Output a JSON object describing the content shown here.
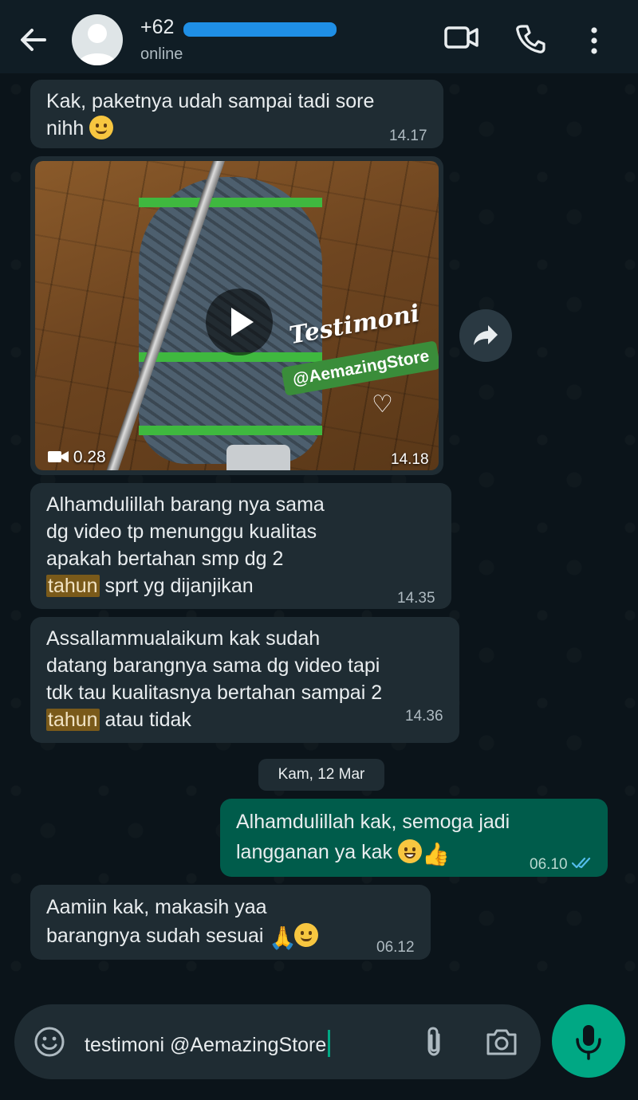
{
  "header": {
    "contact_name": "+62",
    "status": "online",
    "icons": [
      "back-arrow-icon",
      "video-call-icon",
      "voice-call-icon",
      "more-options-icon"
    ]
  },
  "messages": {
    "m1": {
      "line1": "Kak, paketnya udah sampai tadi sore",
      "line2": "nihh",
      "time": "14.17"
    },
    "video": {
      "overlay_title": "Testimoni",
      "overlay_handle": "@AemazingStore",
      "duration": "0.28",
      "time": "14.18"
    },
    "m2": {
      "line1": "Alhamdulillah barang nya sama",
      "line2": "dg video tp menunggu kualitas",
      "line3": "apakah bertahan smp dg 2",
      "highlight": "tahun",
      "line4_rest": " sprt yg dijanjikan",
      "time": "14.35"
    },
    "m3": {
      "line1": "Assallammualaikum kak sudah",
      "line2": "datang barangnya sama dg video tapi",
      "line3": "tdk tau kualitasnya bertahan sampai 2",
      "highlight": "tahun",
      "line4_rest": " atau tidak",
      "time": "14.36"
    },
    "date_chip": "Kam, 12 Mar",
    "m4": {
      "line1": "Alhamdulillah kak, semoga jadi",
      "line2": "langganan ya kak",
      "time": "06.10"
    },
    "m5": {
      "line1": "Aamiin kak, makasih yaa",
      "line2": "barangnya sudah sesuai",
      "time": "06.12"
    }
  },
  "composer": {
    "value": "testimoni @AemazingStore",
    "icons": [
      "emoji-icon",
      "attach-icon",
      "camera-icon",
      "mic-icon"
    ]
  },
  "colors": {
    "background": "#0b141a",
    "incoming_bubble": "#1f2c33",
    "outgoing_bubble": "#005c4b",
    "accent": "#00a884",
    "read_ticks": "#53bdeb",
    "redaction": "#1f8fe6"
  }
}
